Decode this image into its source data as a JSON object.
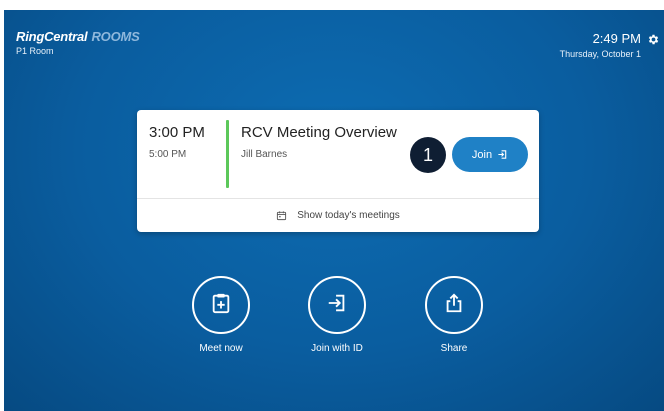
{
  "header": {
    "brand_main": "RingCentral",
    "brand_rooms": "ROOMS",
    "room_name": "P1 Room",
    "time": "2:49 PM",
    "date": "Thursday, October 1"
  },
  "meeting_card": {
    "start_time": "3:00 PM",
    "end_time": "5:00 PM",
    "title": "RCV Meeting Overview",
    "host": "Jill Barnes",
    "badge": "1",
    "join_label": "Join",
    "show_meetings_label": "Show today's meetings"
  },
  "actions": [
    {
      "label": "Meet now",
      "icon": "calendar-plus-icon"
    },
    {
      "label": "Join with ID",
      "icon": "sign-in-icon"
    },
    {
      "label": "Share",
      "icon": "share-upload-icon"
    }
  ],
  "colors": {
    "background": "#0a5d9f",
    "join_button": "#1f81c6",
    "accent_green": "#5cc85a",
    "badge": "#0f1e33"
  }
}
